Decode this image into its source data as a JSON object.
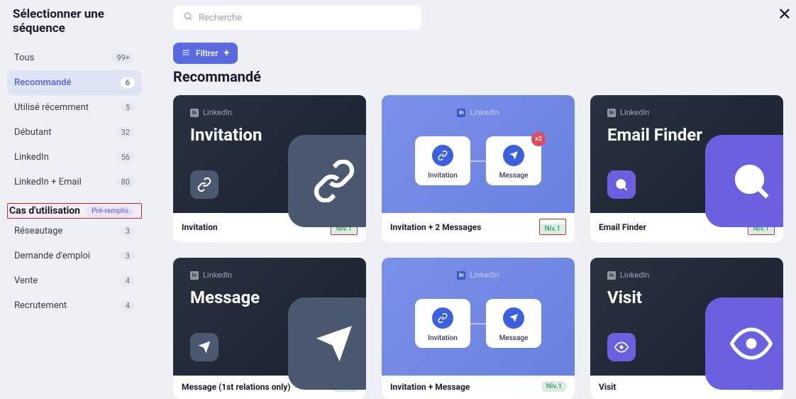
{
  "sidebar": {
    "title": "Sélectionner une séquence",
    "filters": [
      {
        "label": "Tous",
        "count": "99+"
      },
      {
        "label": "Recommandé",
        "count": "6"
      },
      {
        "label": "Utilisé récemment",
        "count": "5"
      },
      {
        "label": "Débutant",
        "count": "32"
      },
      {
        "label": "LinkedIn",
        "count": "56"
      },
      {
        "label": "LinkedIn + Email",
        "count": "80"
      }
    ],
    "usecase_header": "Cas d'utilisation",
    "prefill_tag": "Pré-remplis",
    "usecases": [
      {
        "label": "Réseautage",
        "count": "3"
      },
      {
        "label": "Demande d'emploi",
        "count": "3"
      },
      {
        "label": "Vente",
        "count": "4"
      },
      {
        "label": "Recrutement",
        "count": "4"
      }
    ]
  },
  "search": {
    "placeholder": "Recherche"
  },
  "filter_btn": "Filtrer",
  "section_title": "Recommandé",
  "linkedin_label": "LinkedIn",
  "step_invitation": "Invitation",
  "step_message": "Message",
  "x2_badge": "x2",
  "cards": [
    {
      "vis_title": "Invitation",
      "footer_title": "Invitation",
      "level": "Niv.1"
    },
    {
      "footer_title": "Invitation + 2 Messages",
      "level": "Niv.1"
    },
    {
      "vis_title": "Email Finder",
      "footer_title": "Email Finder",
      "level": "Niv.1"
    },
    {
      "vis_title": "Message",
      "footer_title": "Message (1st relations only)",
      "level": "Niv.1"
    },
    {
      "footer_title": "Invitation + Message",
      "level": "Niv.1"
    },
    {
      "vis_title": "Visit",
      "footer_title": "Visit",
      "level": "Niv.1"
    }
  ]
}
